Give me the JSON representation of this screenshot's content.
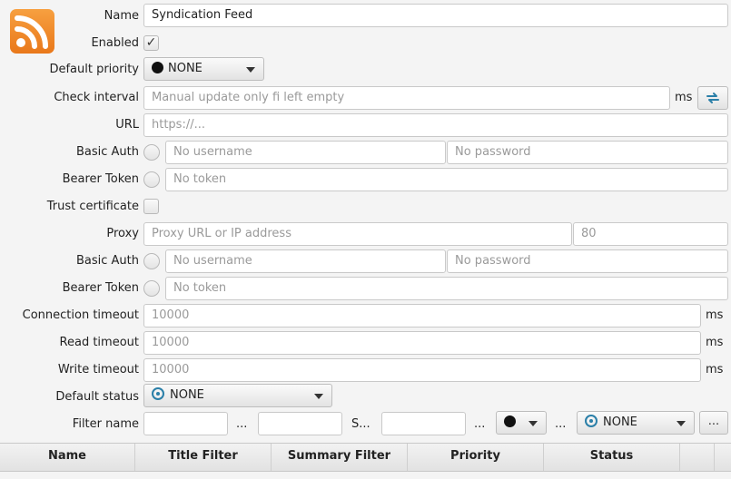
{
  "form": {
    "name_label": "Name",
    "name_value": "Syndication Feed",
    "enabled_label": "Enabled",
    "enabled_checked": true,
    "default_priority_label": "Default priority",
    "default_priority_value": "NONE",
    "check_interval_label": "Check interval",
    "check_interval_placeholder": "Manual update only fi left empty",
    "check_interval_unit": "ms",
    "url_label": "URL",
    "url_placeholder": "https://...",
    "basic_auth_label": "Basic Auth",
    "username_placeholder": "No username",
    "password_placeholder": "No password",
    "bearer_token_label": "Bearer Token",
    "token_placeholder": "No token",
    "trust_certificate_label": "Trust certificate",
    "trust_certificate_checked": false,
    "proxy_label": "Proxy",
    "proxy_placeholder": "Proxy URL or IP address",
    "proxy_port_placeholder": "80",
    "proxy_basic_auth_label": "Basic Auth",
    "proxy_username_placeholder": "No username",
    "proxy_password_placeholder": "No password",
    "proxy_bearer_token_label": "Bearer Token",
    "proxy_token_placeholder": "No token",
    "connection_timeout_label": "Connection timeout",
    "connection_timeout_placeholder": "10000",
    "read_timeout_label": "Read timeout",
    "read_timeout_placeholder": "10000",
    "write_timeout_label": "Write timeout",
    "write_timeout_placeholder": "10000",
    "timeout_unit": "ms",
    "default_status_label": "Default status",
    "default_status_value": "NONE",
    "filter_name_label": "Filter name",
    "filter_sep_1": "...",
    "filter_sep_2": "S...",
    "filter_sep_3": "...",
    "filter_sep_4": "...",
    "filter_status_value": "NONE",
    "more_button_label": "..."
  },
  "table": {
    "columns": [
      "Name",
      "Title Filter",
      "Summary Filter",
      "Priority",
      "Status"
    ]
  },
  "icons": {
    "feed": "rss-feed-icon",
    "refresh": "refresh-icon"
  },
  "colors": {
    "rss_orange": "#f08a24",
    "refresh_blue": "#2a7fa8"
  }
}
